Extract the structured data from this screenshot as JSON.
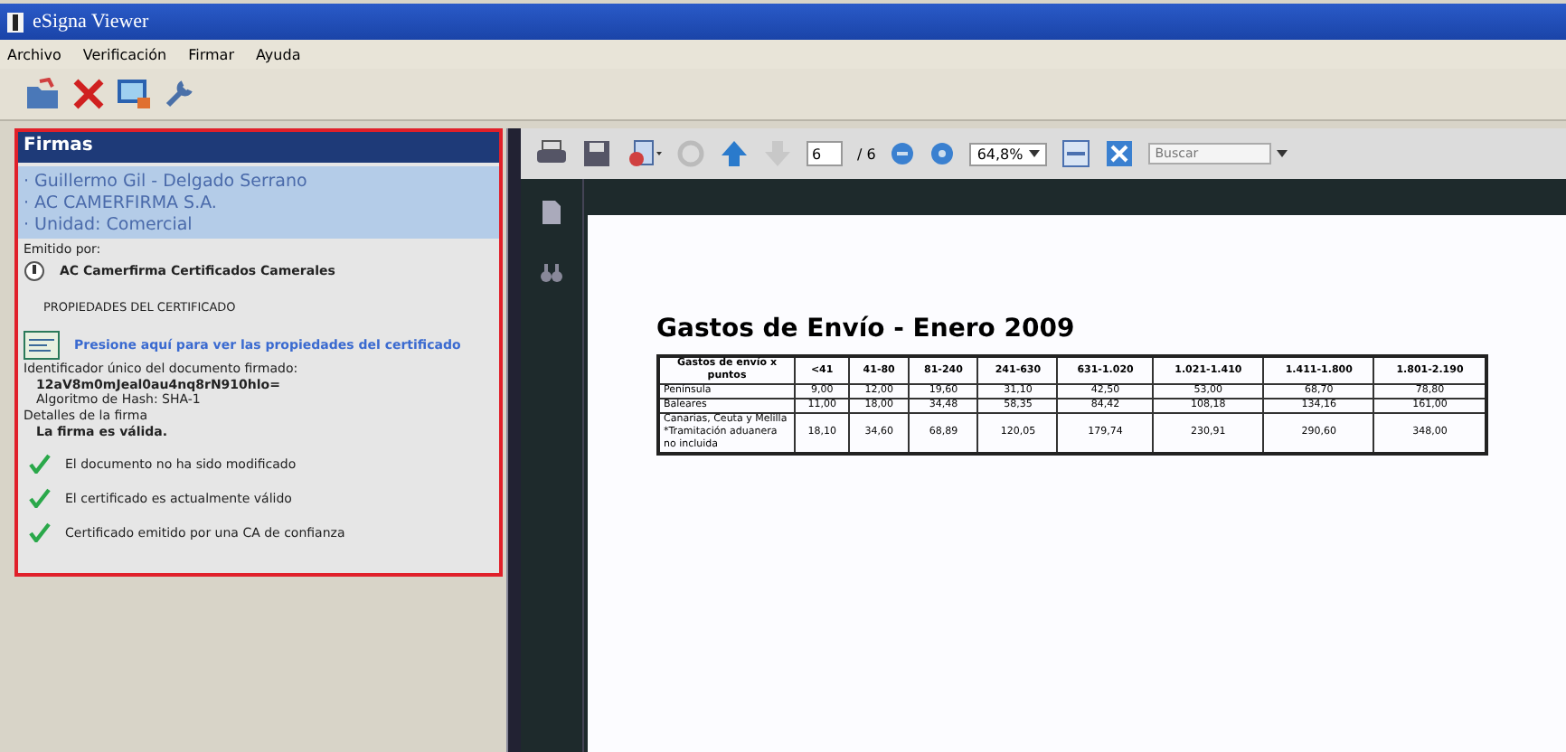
{
  "window": {
    "title": "eSigna Viewer"
  },
  "menu": [
    "Archivo",
    "Verificación",
    "Firmar",
    "Ayuda"
  ],
  "panel": {
    "title": "Firmas",
    "signers": [
      "· Guillermo Gil - Delgado Serrano",
      "· AC CAMERFIRMA S.A.",
      "· Unidad: Comercial"
    ],
    "issued_label": "Emitido por:",
    "issuer": "AC Camerfirma Certificados Camerales",
    "properties_heading": "PROPIEDADES DEL CERTIFICADO",
    "properties_link": "Presione aquí para ver las propiedades del certificado",
    "id_label": "Identificador único del documento firmado:",
    "id_value": "12aV8m0mJeal0au4nq8rN910hlo=",
    "hash": "Algoritmo de Hash: SHA-1",
    "details_label": "Detalles de la firma",
    "result": "La firma es válida.",
    "checks": [
      {
        "text": "El documento no ha sido modificado",
        "ok": true
      },
      {
        "text": "El certificado es actualmente válido",
        "ok": true
      },
      {
        "text": "Certificado emitido por una CA de confianza",
        "ok": true
      }
    ]
  },
  "viewer": {
    "page": "6",
    "page_total": "/ 6",
    "zoom": "64,8%",
    "search": {
      "placeholder": "Buscar"
    },
    "document": {
      "title": "Gastos de Envío - Enero 2009",
      "columns": [
        "Gastos de envío x puntos",
        "<41",
        "41-80",
        "81-240",
        "241-630",
        "631-1.020",
        "1.021-1.410",
        "1.411-1.800",
        "1.801-2.190"
      ],
      "rows": [
        [
          "Península",
          "9,00",
          "12,00",
          "19,60",
          "31,10",
          "42,50",
          "53,00",
          "68,70",
          "78,80"
        ],
        [
          "Baleares",
          "11,00",
          "18,00",
          "34,48",
          "58,35",
          "84,42",
          "108,18",
          "134,16",
          "161,00"
        ],
        [
          "Canarias, Ceuta y Melilla *Tramitación aduanera no incluida",
          "18,10",
          "34,60",
          "68,89",
          "120,05",
          "179,74",
          "230,91",
          "290,60",
          "348,00"
        ]
      ]
    }
  }
}
